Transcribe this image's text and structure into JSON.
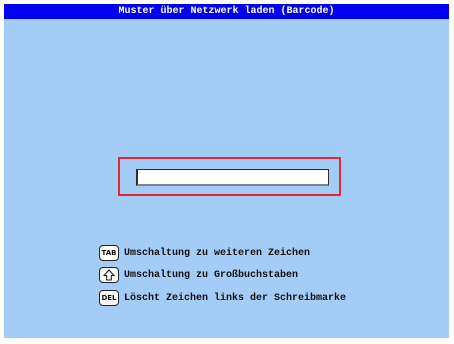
{
  "window": {
    "title": "Muster über Netzwerk laden (Barcode)"
  },
  "input": {
    "value": ""
  },
  "hints": [
    {
      "key": "TAB",
      "text": "Umschaltung zu weiteren Zeichen"
    },
    {
      "key": "shift-arrow-icon",
      "text": "Umschaltung zu Großbuchstaben"
    },
    {
      "key": "DEL",
      "text": "Löscht Zeichen links der Schreibmarke"
    }
  ],
  "colors": {
    "background": "#a3cdf6",
    "titlebar": "#0000f0",
    "focus_frame": "#e8253a"
  }
}
